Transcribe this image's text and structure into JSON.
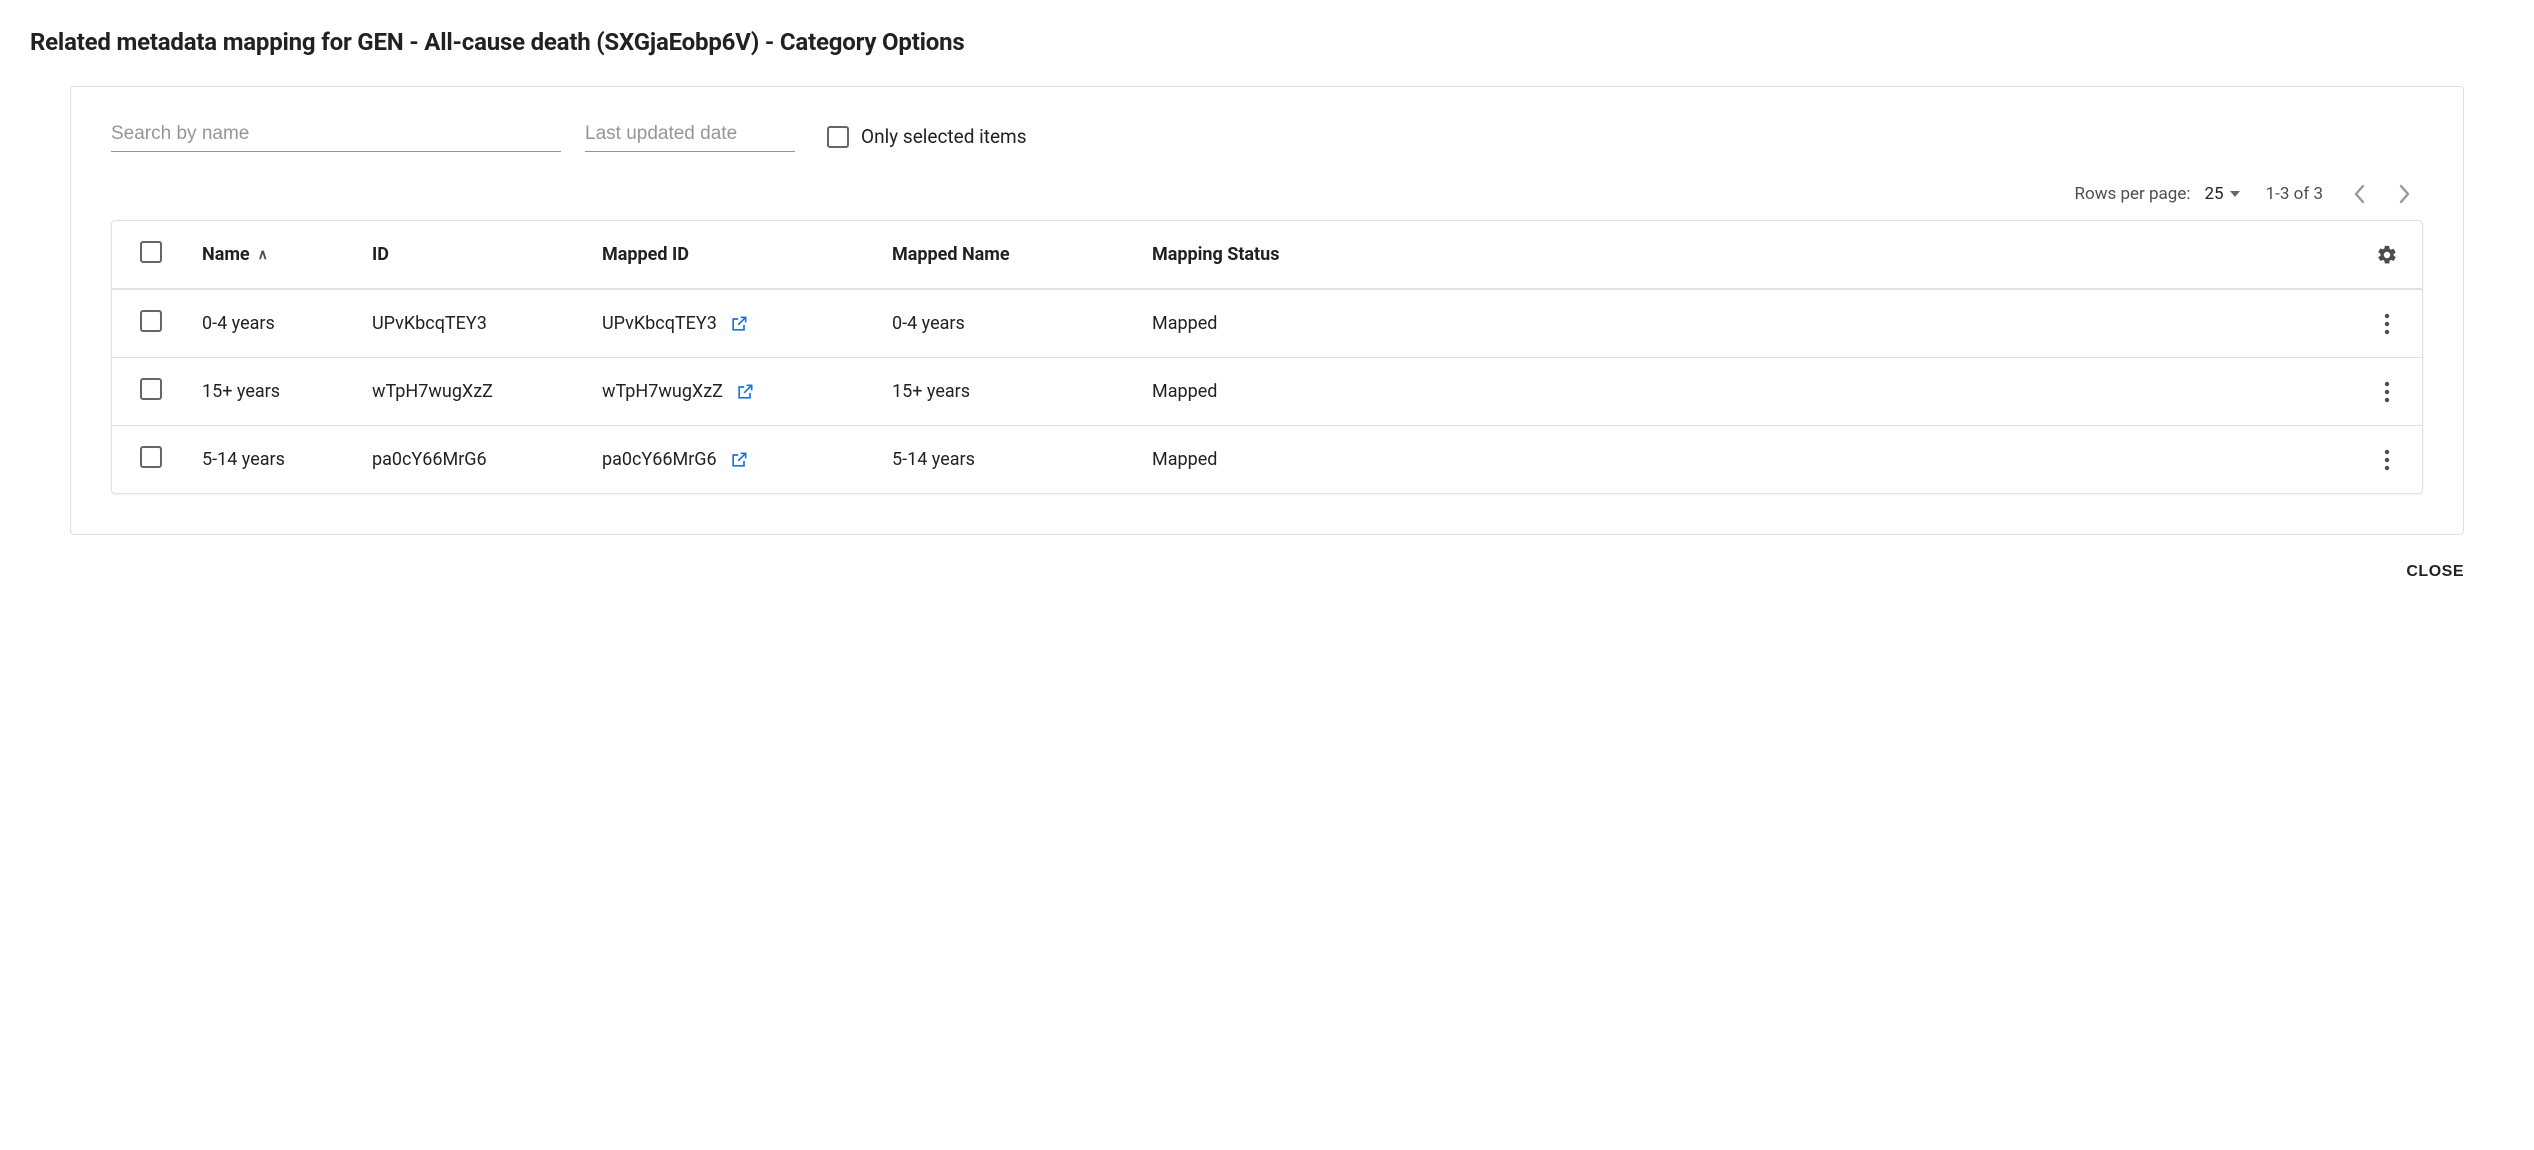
{
  "title": "Related metadata mapping for GEN - All-cause death (SXGjaEobp6V) - Category Options",
  "filters": {
    "search_placeholder": "Search by name",
    "date_placeholder": "Last updated date",
    "only_selected_label": "Only selected items"
  },
  "pager": {
    "rows_per_page_label": "Rows per page:",
    "rows_per_page_value": "25",
    "range": "1-3 of 3"
  },
  "columns": {
    "name": "Name",
    "id": "ID",
    "mapped_id": "Mapped ID",
    "mapped_name": "Mapped Name",
    "status": "Mapping Status"
  },
  "rows": [
    {
      "name": "0-4 years",
      "id": "UPvKbcqTEY3",
      "mapped_id": "UPvKbcqTEY3",
      "mapped_name": "0-4 years",
      "status": "Mapped"
    },
    {
      "name": "15+ years",
      "id": "wTpH7wugXzZ",
      "mapped_id": "wTpH7wugXzZ",
      "mapped_name": "15+ years",
      "status": "Mapped"
    },
    {
      "name": "5-14 years",
      "id": "pa0cY66MrG6",
      "mapped_id": "pa0cY66MrG6",
      "mapped_name": "5-14 years",
      "status": "Mapped"
    }
  ],
  "close_label": "CLOSE"
}
